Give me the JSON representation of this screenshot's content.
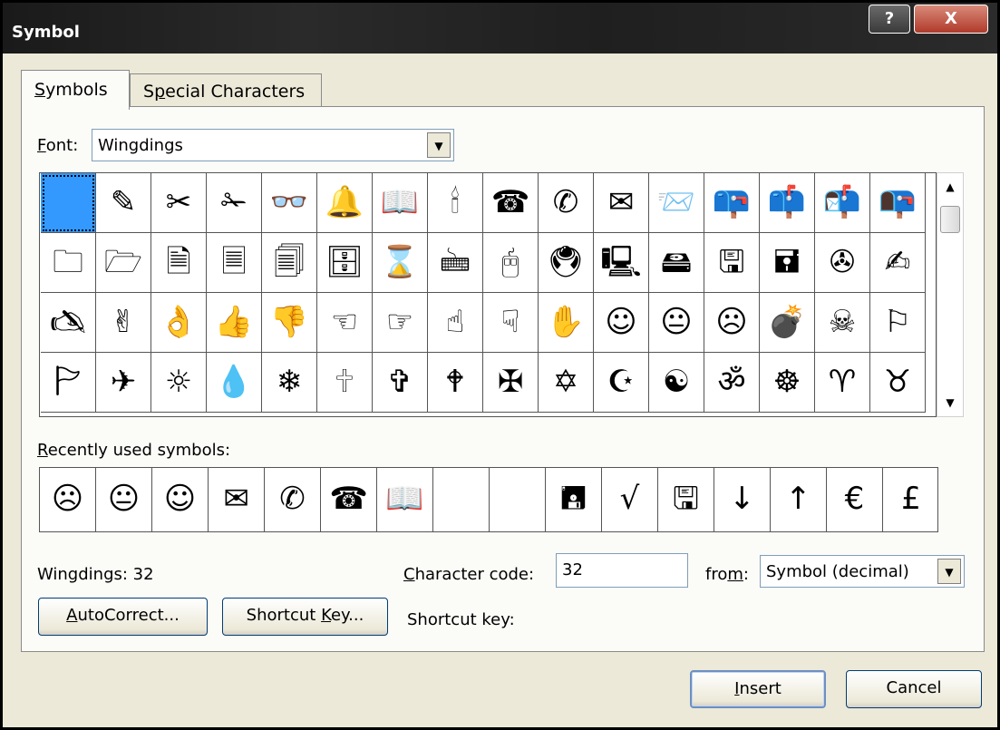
{
  "window": {
    "title": "Symbol",
    "help_label": "?",
    "close_label": "X"
  },
  "tabs": [
    {
      "label": "Symbols",
      "accel": "S",
      "active": true
    },
    {
      "label": "Special Characters",
      "accel": "p",
      "active": false
    }
  ],
  "font": {
    "label": "Font:",
    "accel": "F",
    "value": "Wingdings"
  },
  "symbol_grid": {
    "rows": [
      [
        "",
        "✎",
        "✂",
        "✁",
        "👓",
        "🔔",
        "📖",
        "🕯",
        "☎",
        "✆",
        "✉",
        "📨",
        "📪",
        "📫",
        "📬",
        "📭"
      ],
      [
        "🗀",
        "🗁",
        "🗎",
        "🗏",
        "🗐",
        "🗄",
        "⌛",
        "🖮",
        "🖰",
        "🖲",
        "🖳",
        "🖴",
        "🖫",
        "🖬",
        "✇",
        "✍"
      ],
      [
        "🖎",
        "✌",
        "👌",
        "👍",
        "👎",
        "☜",
        "☞",
        "☝",
        "☟",
        "✋",
        "☺",
        "😐",
        "☹",
        "💣",
        "☠",
        "⚐"
      ],
      [
        "🏱",
        "✈",
        "☼",
        "💧",
        "❄",
        "🕆",
        "✞",
        "🕈",
        "✠",
        "✡",
        "☪",
        "☯",
        "ॐ",
        "☸",
        "♈",
        "♉"
      ]
    ],
    "selected": {
      "row": 0,
      "col": 0
    },
    "accent": "#3399ff"
  },
  "recent": {
    "label": "Recently used symbols:",
    "accel": "R",
    "items": [
      "☹",
      "😐",
      "☺",
      "✉",
      "✆",
      "☎",
      "📖",
      "",
      "",
      "🖪",
      "√",
      "🖫",
      "↓",
      "↑",
      "€",
      "£"
    ]
  },
  "status": {
    "char_name": "Wingdings: 32"
  },
  "char_code": {
    "label": "Character code:",
    "accel": "C",
    "value": "32"
  },
  "from": {
    "label": "from:",
    "accel": "m",
    "value": "Symbol (decimal)"
  },
  "buttons": {
    "autocorrect": "AutoCorrect...",
    "autocorrect_accel": "A",
    "shortcut_key": "Shortcut Key...",
    "shortcut_key_accel": "K",
    "insert": "Insert",
    "insert_accel": "I",
    "cancel": "Cancel"
  },
  "shortcut_key_text": "Shortcut key:"
}
